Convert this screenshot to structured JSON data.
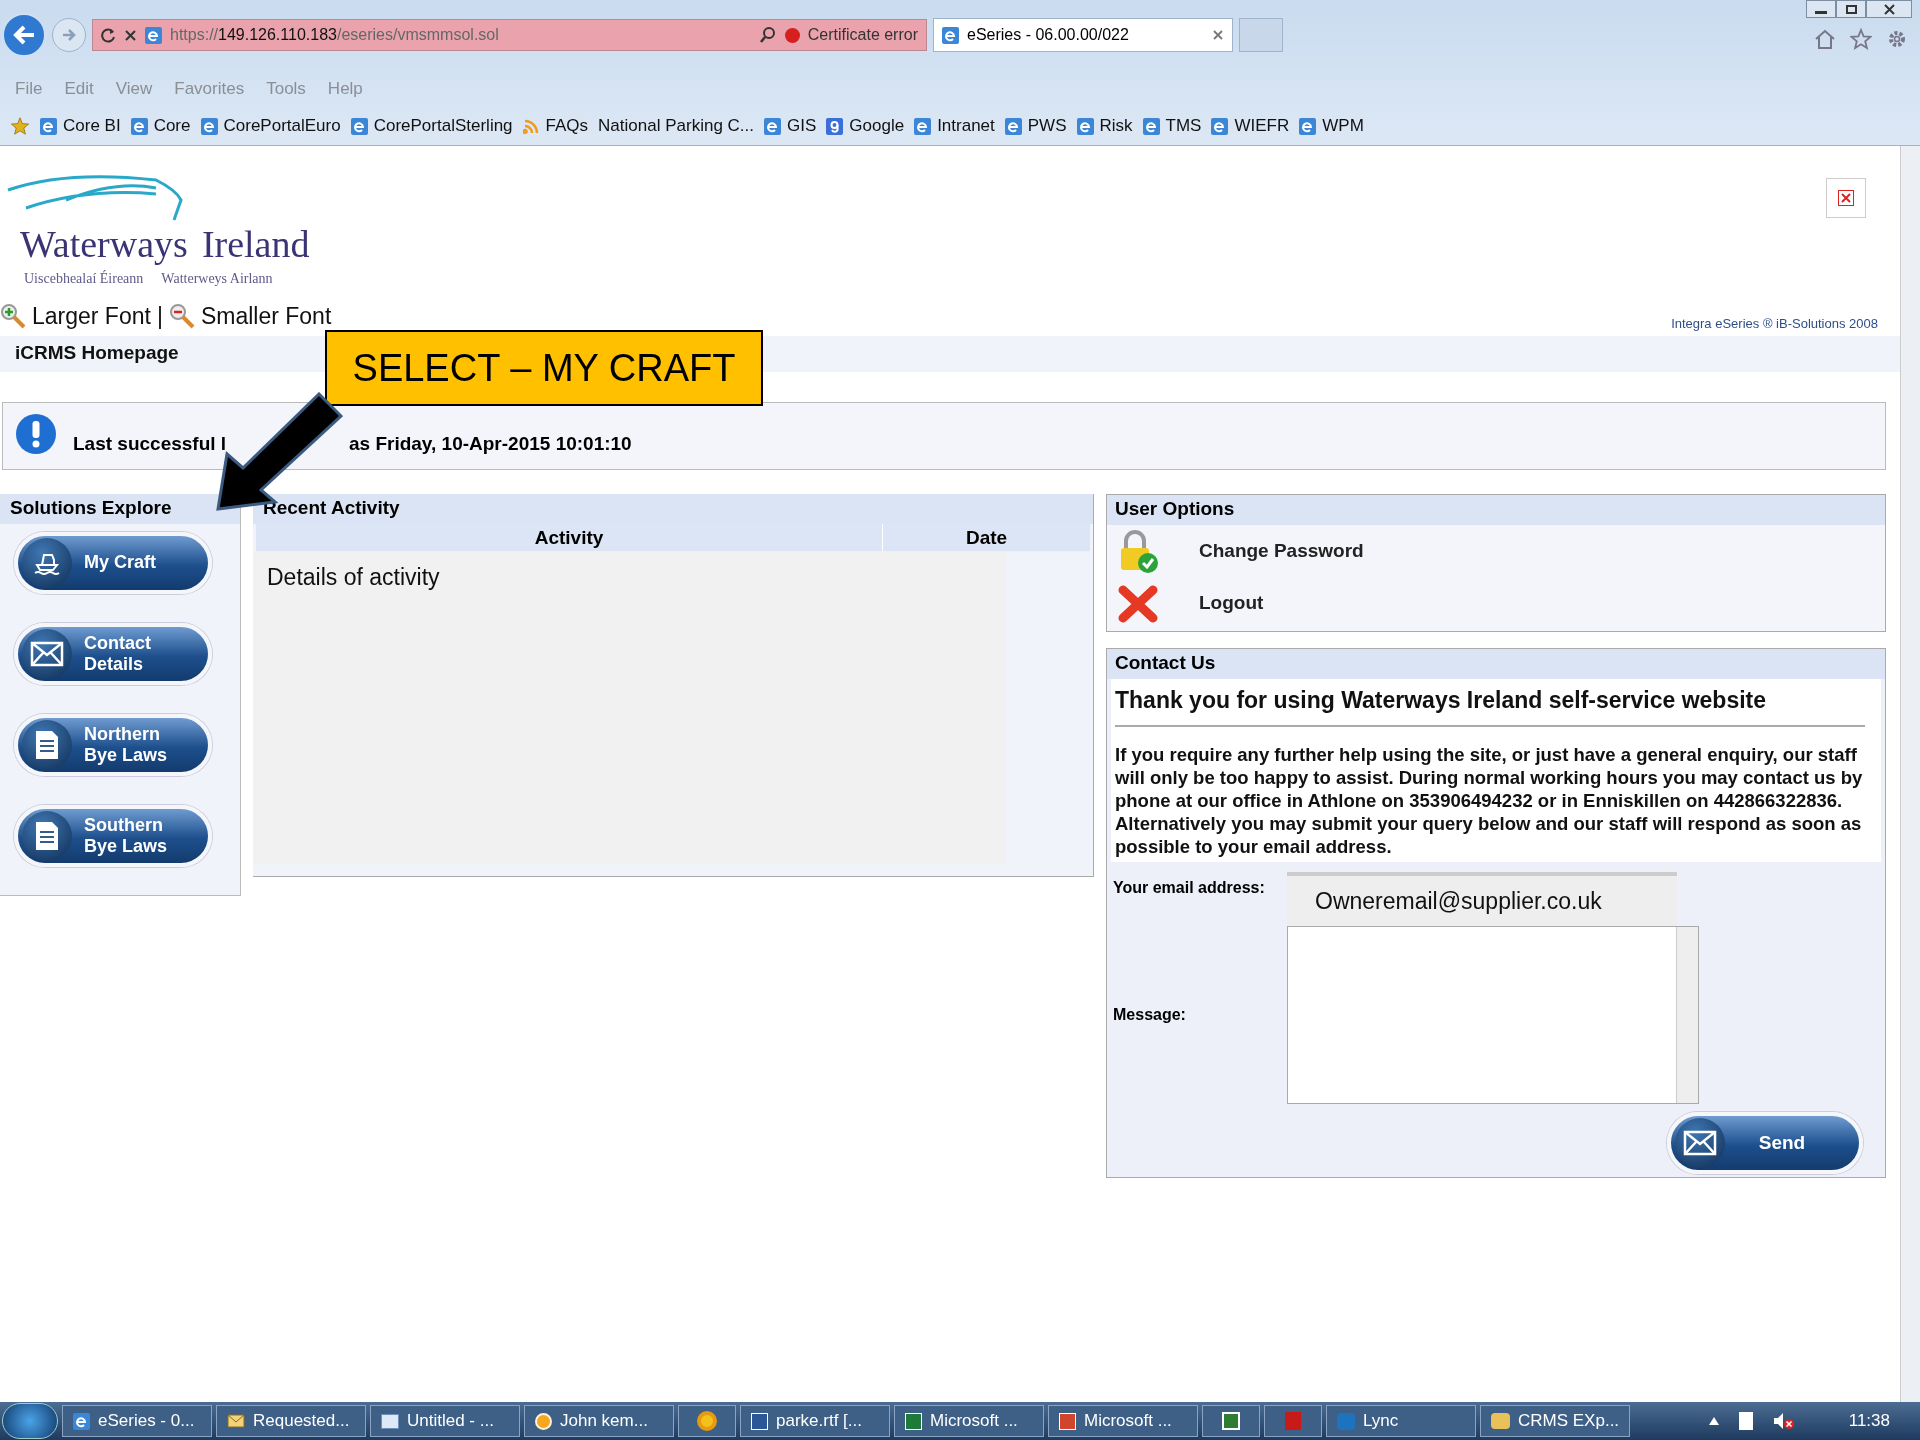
{
  "browser": {
    "address": {
      "scheme": "https://",
      "host": "149.126.110.183",
      "path": "/eseries/vmsmmsol.sol"
    },
    "certificate_error": "Certificate error",
    "tabs": [
      {
        "label": "eSeries - 06.00.00/022",
        "selected": true
      }
    ],
    "menu": [
      "File",
      "Edit",
      "View",
      "Favorites",
      "Tools",
      "Help"
    ],
    "favorites": [
      {
        "label": "Core BI",
        "kind": "ie"
      },
      {
        "label": "Core",
        "kind": "ie"
      },
      {
        "label": "CorePortalEuro",
        "kind": "ie"
      },
      {
        "label": "CorePortalSterling",
        "kind": "ie"
      },
      {
        "label": "FAQs",
        "kind": "feed"
      },
      {
        "label": "National Parking C...",
        "kind": "plain"
      },
      {
        "label": "GIS",
        "kind": "ie"
      },
      {
        "label": "Google",
        "kind": "google"
      },
      {
        "label": "Intranet",
        "kind": "ie"
      },
      {
        "label": "PWS",
        "kind": "ie"
      },
      {
        "label": "Risk",
        "kind": "ie"
      },
      {
        "label": "TMS",
        "kind": "ie"
      },
      {
        "label": "WIEFR",
        "kind": "ie"
      },
      {
        "label": "WPM",
        "kind": "ie"
      }
    ]
  },
  "page": {
    "logo": {
      "word1": "Waterways",
      "word2": "Ireland",
      "sub1": "Uiscebhealaí Éireann",
      "sub2": "Watterweys Airlann"
    },
    "font_links": [
      {
        "label": "Larger Font",
        "kind": "zoom-in"
      },
      {
        "label": "Smaller Font",
        "kind": "zoom-out"
      }
    ],
    "separator": "|",
    "copyright": "Integra eSeries ® iB-Solutions 2008",
    "breadcrumb": "iCRMS Homepage",
    "login_notice": [
      "Last successful l",
      "as Friday, 10-Apr-2015 10:01:10"
    ],
    "solutions": {
      "title": "Solutions Explore",
      "items": [
        {
          "label": "My Craft",
          "kind": "boat"
        },
        {
          "label": "Contact Details",
          "kind": "mail"
        },
        {
          "label": "Northern Bye Laws",
          "kind": "document"
        },
        {
          "label": "Southern Bye Laws",
          "kind": "document"
        }
      ]
    },
    "recent_activity": {
      "title": "Recent Activity",
      "columns": [
        "Activity",
        "Date"
      ],
      "cover_note": "Details of activity"
    },
    "user_options": {
      "title": "User Options",
      "items": [
        {
          "label": "Change Password",
          "kind": "lock"
        },
        {
          "label": "Logout",
          "kind": "cross"
        }
      ]
    },
    "contact": {
      "title": "Contact Us",
      "heading": "Thank you for using Waterways Ireland self-service website",
      "body": "If you require any further help using the site, or just have a general enquiry, our staff will only be too happy to assist. During normal working hours you may contact us by phone at our office in Athlone on 353906494232 or in Enniskillen on 442866322836. Alternatively you may submit your query below and our staff will respond as soon as possible to your email address.",
      "email_label": "Your email address:",
      "email_cover": "Owneremail@supplier.co.uk",
      "message_label": "Message:",
      "send": "Send"
    }
  },
  "annotation": {
    "callout": "SELECT – MY CRAFT"
  },
  "taskbar": {
    "items": [
      {
        "label": "eSeries - 0...",
        "kind": "ie"
      },
      {
        "label": "Requested...",
        "kind": "mail"
      },
      {
        "label": "Untitled - ...",
        "kind": "window"
      },
      {
        "label": "John kem...",
        "kind": "chat"
      },
      {
        "kind": "flower"
      },
      {
        "label": "parke.rtf [...",
        "kind": "word"
      },
      {
        "label": "Microsoft ...",
        "kind": "excel"
      },
      {
        "label": "Microsoft ...",
        "kind": "ppt"
      },
      {
        "kind": "network"
      },
      {
        "kind": "pdf"
      },
      {
        "label": "Lync",
        "kind": "lync"
      },
      {
        "label": "CRMS EXp...",
        "kind": "folder"
      }
    ],
    "clock": "11:38"
  }
}
